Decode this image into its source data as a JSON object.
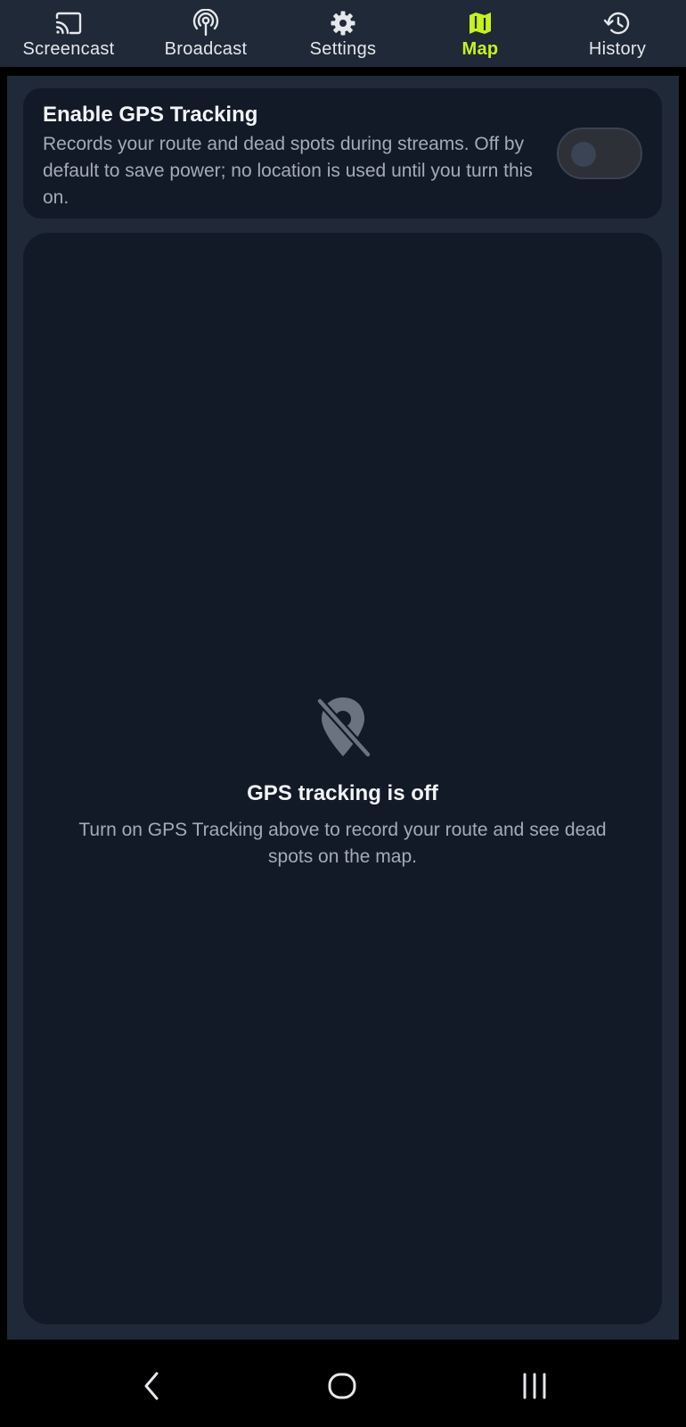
{
  "tabs": [
    {
      "label": "Screencast",
      "icon": "cast-icon",
      "active": false
    },
    {
      "label": "Broadcast",
      "icon": "broadcast-icon",
      "active": false
    },
    {
      "label": "Settings",
      "icon": "gear-icon",
      "active": false
    },
    {
      "label": "Map",
      "icon": "map-icon",
      "active": true
    },
    {
      "label": "History",
      "icon": "history-icon",
      "active": false
    }
  ],
  "gps_card": {
    "title": "Enable GPS Tracking",
    "description": "Records your route and dead spots during streams. Off by default to save power; no location is used until you turn this on.",
    "toggle_on": false
  },
  "map_panel": {
    "empty_icon": "location-off-icon",
    "empty_title": "GPS tracking is off",
    "empty_text": "Turn on GPS Tracking above to record your route and see dead spots on the map."
  },
  "system_nav": {
    "back_icon": "back-icon",
    "home_icon": "home-icon",
    "recents_icon": "recents-icon"
  },
  "colors": {
    "accent": "#c6f31a",
    "background": "#1f2937",
    "card": "#121a28",
    "muted_text": "#a4abb6"
  }
}
